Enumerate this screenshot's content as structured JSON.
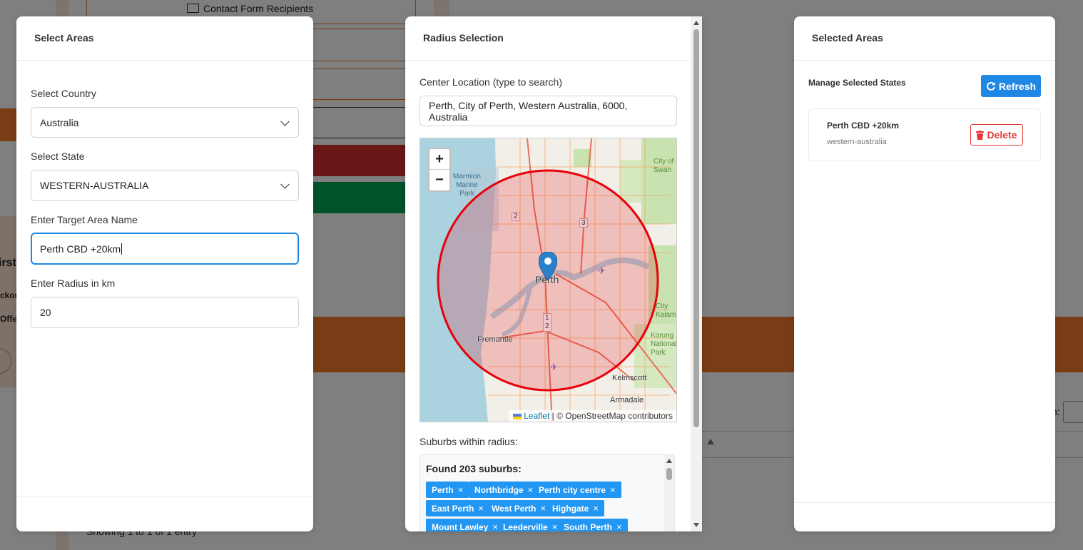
{
  "background": {
    "contact_form_recipients": "Contact Form Recipients",
    "showing_text": "Showing 1 to 1 of 1 entry",
    "partial_label_1": "irst",
    "partial_label_2": "ckou",
    "partial_label_3": "Offe",
    "partial_search": "h:"
  },
  "select_areas": {
    "title": "Select Areas",
    "country_label": "Select Country",
    "country_value": "Australia",
    "state_label": "Select State",
    "state_value": "WESTERN-AUSTRALIA",
    "area_name_label": "Enter Target Area Name",
    "area_name_value": "Perth CBD +20km",
    "radius_label": "Enter Radius in km",
    "radius_value": "20"
  },
  "radius_selection": {
    "title": "Radius Selection",
    "center_label": "Center Location (type to search)",
    "center_value": "Perth, City of Perth, Western Australia, 6000, Australia",
    "map": {
      "zoom_in": "+",
      "zoom_out": "−",
      "attribution_leaflet": "Leaflet",
      "attribution_osm": " | © OpenStreetMap contributors",
      "places": {
        "perth": "Perth",
        "fremantle": "Fremantle",
        "kelmscott": "Kelmscott",
        "armadale": "Armadale",
        "marmion_1": "Marmion",
        "marmion_2": "Marine",
        "marmion_3": "Park",
        "swan_1": "City of",
        "swan_2": "Swan",
        "kalamunda_1": "City",
        "kalamunda_2": "Kalam",
        "korung_1": "Korung",
        "korung_2": "National",
        "korung_3": "Park",
        "route_2": "2",
        "route_3": "3",
        "route_1b": "1",
        "route_2b": "2"
      },
      "radius_km": 20,
      "circle_color": "#e8000b"
    },
    "suburbs_label": "Suburbs within radius:",
    "found_text": "Found 203 suburbs:",
    "suburbs": [
      "Perth",
      "Northbridge",
      "Perth city centre",
      "East Perth",
      "West Perth",
      "Highgate",
      "Mount Lawley",
      "Leederville",
      "South Perth"
    ],
    "remove_glyph": "×"
  },
  "selected_areas": {
    "title": "Selected Areas",
    "manage_label": "Manage Selected States",
    "refresh_label": "Refresh",
    "items": [
      {
        "name": "Perth CBD +20km",
        "state": "western-australia",
        "delete_label": "Delete"
      }
    ]
  },
  "colors": {
    "primary": "#1f88e5",
    "danger": "#e53935",
    "tag": "#2196f3",
    "bg_orange": "#f07b2a",
    "bg_red": "#d32f2f",
    "bg_green": "#00a651"
  }
}
